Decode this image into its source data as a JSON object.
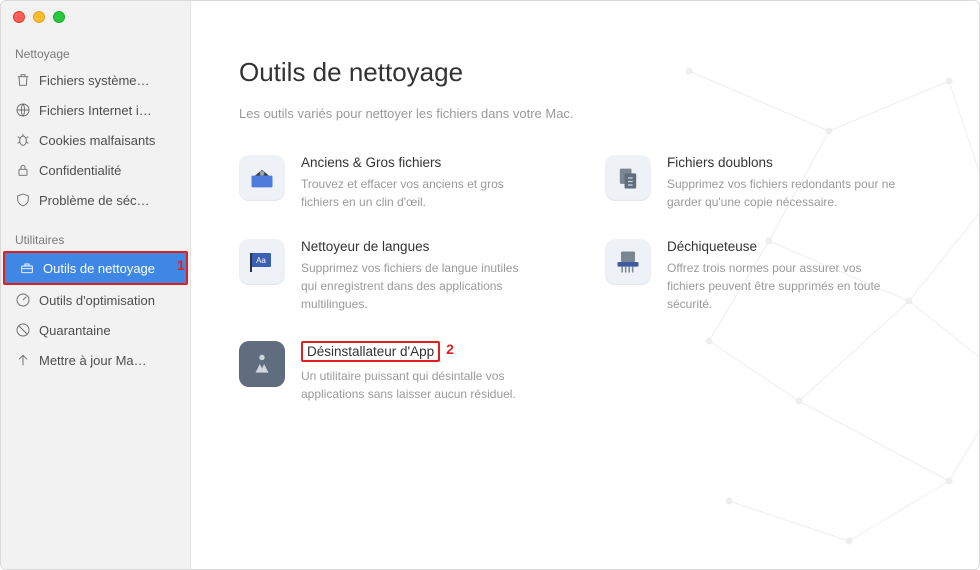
{
  "sidebar": {
    "section1": "Nettoyage",
    "section2": "Utilitaires",
    "items": [
      {
        "label": "Fichiers système…"
      },
      {
        "label": "Fichiers Internet i…"
      },
      {
        "label": "Cookies malfaisants"
      },
      {
        "label": "Confidentialité"
      },
      {
        "label": "Problème de séc…"
      },
      {
        "label": "Outils de nettoyage"
      },
      {
        "label": "Outils d'optimisation"
      },
      {
        "label": "Quarantaine"
      },
      {
        "label": "Mettre à jour Ma…"
      }
    ]
  },
  "page": {
    "title": "Outils de nettoyage",
    "subtitle": "Les outils variés pour nettoyer les fichiers dans votre Mac."
  },
  "tools": [
    {
      "title": "Anciens & Gros fichiers",
      "desc": "Trouvez et effacer vos anciens et gros fichiers en un clin d'œil."
    },
    {
      "title": "Fichiers doublons",
      "desc": "Supprimez vos fichiers redondants pour ne garder qu'une copie nécessaire."
    },
    {
      "title": "Nettoyeur de langues",
      "desc": "Supprimez vos fichiers de langue inutiles qui enregistrent dans des applications multilingues."
    },
    {
      "title": "Déchiqueteuse",
      "desc": "Offrez trois normes pour assurer vos fichiers peuvent être supprimés en toute sécurité."
    },
    {
      "title": "Désinstallateur d'App",
      "desc": "Un utilitaire puissant qui désintalle vos applications sans laisser aucun résiduel."
    }
  ],
  "annotations": {
    "one": "1",
    "two": "2"
  }
}
